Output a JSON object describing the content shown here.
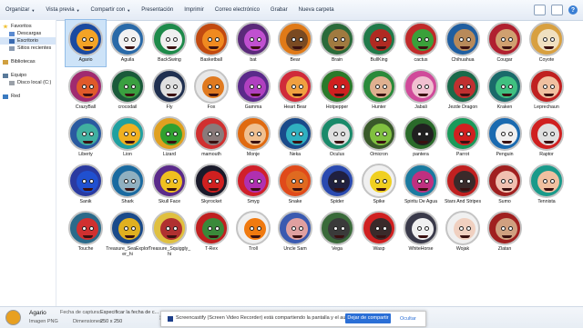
{
  "toolbar": {
    "items": [
      "Organizar",
      "Vista previa",
      "Compartir con",
      "Presentación",
      "Imprimir",
      "Correo electrónico",
      "Grabar",
      "Nueva carpeta"
    ]
  },
  "nav": {
    "favorites_title": "Favoritos",
    "favorites": [
      "Descargas",
      "Escritorio",
      "Sitios recientes"
    ],
    "libraries": "Bibliotecas",
    "computer_title": "Equipo",
    "computer": [
      "Disco local (C:)"
    ],
    "network": "Red"
  },
  "tiles": [
    {
      "label": "Agario",
      "bg": "#1b4aa0",
      "fg": "#f3a326",
      "sel": true
    },
    {
      "label": "Aguila",
      "bg": "#2a6aa8",
      "fg": "#f2f2f2"
    },
    {
      "label": "BackSwing",
      "bg": "#1e8a4a",
      "fg": "#f0f0f0"
    },
    {
      "label": "Basketball",
      "bg": "#c24a10",
      "fg": "#f08a20"
    },
    {
      "label": "bat",
      "bg": "#5b2a7a",
      "fg": "#c050d0"
    },
    {
      "label": "Bear",
      "bg": "#e07a18",
      "fg": "#7a4a22"
    },
    {
      "label": "Brain",
      "bg": "#2a6a3a",
      "fg": "#a07a40"
    },
    {
      "label": "BullKing",
      "bg": "#207a4a",
      "fg": "#b02a22"
    },
    {
      "label": "cactus",
      "bg": "#c02a2a",
      "fg": "#3aa03a"
    },
    {
      "label": "Chihuahua",
      "bg": "#1f5ea0",
      "fg": "#b88a5a"
    },
    {
      "label": "Cougar",
      "bg": "#b02030",
      "fg": "#d0a070"
    },
    {
      "label": "Coyote",
      "bg": "#d8a040",
      "fg": "#f0e0c0"
    },
    {
      "label": "CrazyBall",
      "bg": "#a02a70",
      "fg": "#e05a2a"
    },
    {
      "label": "crocodail",
      "bg": "#1a5a3a",
      "fg": "#3aa040"
    },
    {
      "label": "Fly",
      "bg": "#203050",
      "fg": "#e0e0e0"
    },
    {
      "label": "Fox",
      "bg": "#e8e8e8",
      "fg": "#e07a20"
    },
    {
      "label": "Gamma",
      "bg": "#5a2a8a",
      "fg": "#b040c0"
    },
    {
      "label": "Heart Bear",
      "bg": "#d02a3a",
      "fg": "#f0a040"
    },
    {
      "label": "Hotpepper",
      "bg": "#2a7a2a",
      "fg": "#d02020"
    },
    {
      "label": "Hunter",
      "bg": "#2a8a3a",
      "fg": "#e0b090"
    },
    {
      "label": "Jabali",
      "bg": "#d04a9a",
      "fg": "#f0c0d0"
    },
    {
      "label": "Jezde Dragon",
      "bg": "#1a6a4a",
      "fg": "#c03030"
    },
    {
      "label": "Kraken",
      "bg": "#1a6a6a",
      "fg": "#40c080"
    },
    {
      "label": "Leprechaun",
      "bg": "#c02020",
      "fg": "#f0c0a0"
    },
    {
      "label": "Liberty",
      "bg": "#2a5aa0",
      "fg": "#40b0a0"
    },
    {
      "label": "Lion",
      "bg": "#20a0a0",
      "fg": "#f0b020"
    },
    {
      "label": "Lizard",
      "bg": "#e0a020",
      "fg": "#30a030"
    },
    {
      "label": "mamouth",
      "bg": "#d03030",
      "fg": "#8a7a7a"
    },
    {
      "label": "Monje",
      "bg": "#e06a10",
      "fg": "#f0c090"
    },
    {
      "label": "Neka",
      "bg": "#1a4a8a",
      "fg": "#30b0c0"
    },
    {
      "label": "Oculus",
      "bg": "#1a8a6a",
      "fg": "#e0e0e0"
    },
    {
      "label": "Omicron",
      "bg": "#3a5a2a",
      "fg": "#80c040"
    },
    {
      "label": "pantera",
      "bg": "#2a6a2a",
      "fg": "#202020"
    },
    {
      "label": "Parrot",
      "bg": "#1a9a5a",
      "fg": "#d02020"
    },
    {
      "label": "Penguin",
      "bg": "#1a6ab0",
      "fg": "#f0f0f0"
    },
    {
      "label": "Raptor",
      "bg": "#d02020",
      "fg": "#e0e0e0"
    },
    {
      "label": "Sanik",
      "bg": "#2a3aa0",
      "fg": "#2050d0"
    },
    {
      "label": "Shark",
      "bg": "#1a6aa0",
      "fg": "#90b0c0"
    },
    {
      "label": "Skull Face",
      "bg": "#5a2a8a",
      "fg": "#f0c020"
    },
    {
      "label": "Skyrocket",
      "bg": "#1a1a2a",
      "fg": "#d02020"
    },
    {
      "label": "Smyg",
      "bg": "#d0202a",
      "fg": "#b030b0"
    },
    {
      "label": "Snake",
      "bg": "#e04a1a",
      "fg": "#e06a20"
    },
    {
      "label": "Spider",
      "bg": "#2a4ab0",
      "fg": "#202040"
    },
    {
      "label": "Spike",
      "bg": "#f0f0f0",
      "fg": "#f0d020"
    },
    {
      "label": "Spiritu De Agua",
      "bg": "#1a7aa0",
      "fg": "#c03080"
    },
    {
      "label": "Stars And Stripes",
      "bg": "#c02020",
      "fg": "#3a2a2a"
    },
    {
      "label": "Sumo",
      "bg": "#a02020",
      "fg": "#f0c0b0"
    },
    {
      "label": "Tennista",
      "bg": "#1a9a8a",
      "fg": "#f0c0a0"
    },
    {
      "label": "Touche",
      "bg": "#2a6a8a",
      "fg": "#d03030"
    },
    {
      "label": "Treasure_SeaExplorer_hi",
      "bg": "#1a4a8a",
      "fg": "#e0b020"
    },
    {
      "label": "Treasure_Squiggly_hi",
      "bg": "#e0c040",
      "fg": "#b03030"
    },
    {
      "label": "T-Rex",
      "bg": "#c02020",
      "fg": "#3a8a3a"
    },
    {
      "label": "Troll",
      "bg": "#f0f0f0",
      "fg": "#f07a10"
    },
    {
      "label": "Uncle Sam",
      "bg": "#3a5ab0",
      "fg": "#e0a0a0"
    },
    {
      "label": "Vega",
      "bg": "#3a6a3a",
      "fg": "#3a3a3a"
    },
    {
      "label": "Wasp",
      "bg": "#d02020",
      "fg": "#3a2a2a"
    },
    {
      "label": "WhiteHorse",
      "bg": "#3a3a4a",
      "fg": "#f0f0f0"
    },
    {
      "label": "Wojak",
      "bg": "#f0f0f0",
      "fg": "#f0d0c0"
    },
    {
      "label": "Zlatan",
      "bg": "#a02020",
      "fg": "#d0a080"
    }
  ],
  "details": {
    "name": "Agario",
    "type": "Imagen PNG",
    "date_key": "Fecha de captura:",
    "date_value": "Especificar la fecha de c...",
    "dim_key": "Dimensiones:",
    "dim_value": "250 x 250"
  },
  "notification": {
    "text": "Screencastify (Screen Video Recorder) está compartiendo la pantalla y el audio.",
    "stop_label": "Dejar de compartir",
    "hide_label": "Ocultar"
  }
}
